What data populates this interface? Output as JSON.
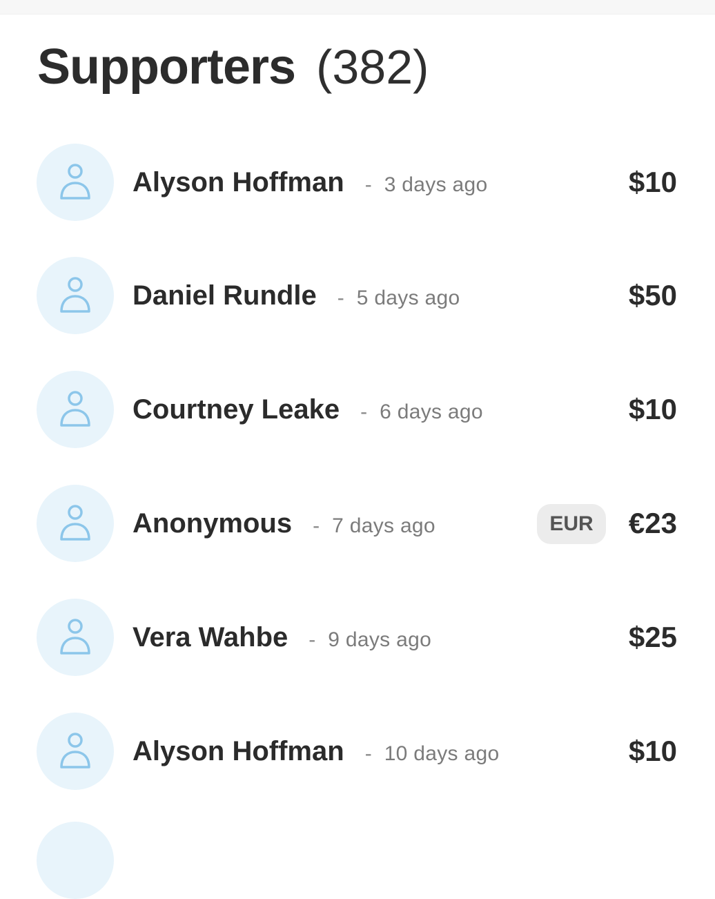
{
  "header": {
    "title": "Supporters",
    "count": "(382)"
  },
  "supporters": [
    {
      "name": "Alyson Hoffman",
      "separator": "-",
      "time": "3 days ago",
      "amount": "$10",
      "currency_badge": ""
    },
    {
      "name": "Daniel Rundle",
      "separator": "-",
      "time": "5 days ago",
      "amount": "$50",
      "currency_badge": ""
    },
    {
      "name": "Courtney Leake",
      "separator": "-",
      "time": "6 days ago",
      "amount": "$10",
      "currency_badge": ""
    },
    {
      "name": "Anonymous",
      "separator": "-",
      "time": "7 days ago",
      "amount": "€23",
      "currency_badge": "EUR"
    },
    {
      "name": "Vera Wahbe",
      "separator": "-",
      "time": "9 days ago",
      "amount": "$25",
      "currency_badge": ""
    },
    {
      "name": "Alyson Hoffman",
      "separator": "-",
      "time": "10 days ago",
      "amount": "$10",
      "currency_badge": ""
    }
  ],
  "icons": {
    "avatar": "user-icon"
  },
  "colors": {
    "avatar_bg": "#e8f4fb",
    "avatar_icon": "#8cc6ea",
    "badge_bg": "#ececec"
  }
}
